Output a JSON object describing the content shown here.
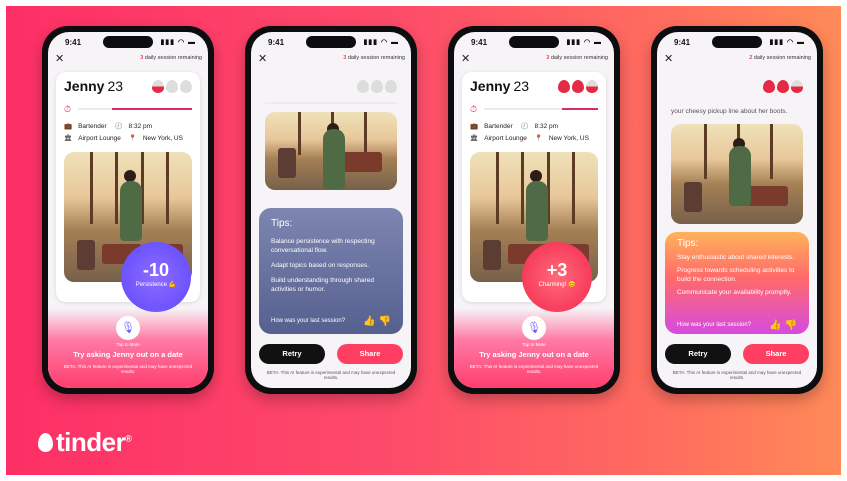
{
  "brand": {
    "logo_text": "tinder",
    "reg": "®",
    "colors": {
      "primary": "#fd2f66",
      "accent": "#ff8a58"
    }
  },
  "phones": [
    {
      "time": "9:41",
      "remaining": "3 daily session remaining",
      "name": "Jenny",
      "age": "23",
      "job": "Bartender",
      "clock": "8:32 pm",
      "place": "Airport Lounge",
      "location": "New York, US",
      "score": "-10",
      "score_label": "Persistence",
      "score_icon": "💪",
      "tap": "Tap to Mute",
      "prompt": "Try asking Jenny out on a date",
      "beta": "BETA: This AI feature is experimental and may have unexpected results."
    },
    {
      "time": "9:41",
      "remaining": "3 daily session remaining",
      "tips_title": "Tips:",
      "tips": [
        "Balance persistence with respecting conversational flow.",
        "Adapt topics based on responses.",
        "Build understanding through shared activities or humor."
      ],
      "feedback": "How was your last session?",
      "retry": "Retry",
      "share": "Share",
      "beta": "BETA: This AI feature is experimental and may have unexpected results."
    },
    {
      "time": "9:41",
      "remaining": "3 daily session remaining",
      "name": "Jenny",
      "age": "23",
      "job": "Bartender",
      "clock": "8:32 pm",
      "place": "Airport Lounge",
      "location": "New York, US",
      "score": "+3",
      "score_label": "Charming!",
      "score_icon": "😊",
      "tap": "Tap to Mute",
      "prompt": "Try asking Jenny out on a date",
      "beta": "BETA: This AI feature is experimental and may have unexpected results."
    },
    {
      "time": "9:41",
      "remaining": "2 daily session remaining",
      "top_text": "your cheesy pickup line about her boots.",
      "tips_title": "Tips:",
      "tips": [
        "Stay enthusiastic about shared interests.",
        "Progress towards scheduling activities to build the connection.",
        "Communicate your availability promptly."
      ],
      "feedback": "How was your last session?",
      "retry": "Retry",
      "share": "Share",
      "beta": "BETA: This AI feature is experimental and may have unexpected results."
    }
  ]
}
